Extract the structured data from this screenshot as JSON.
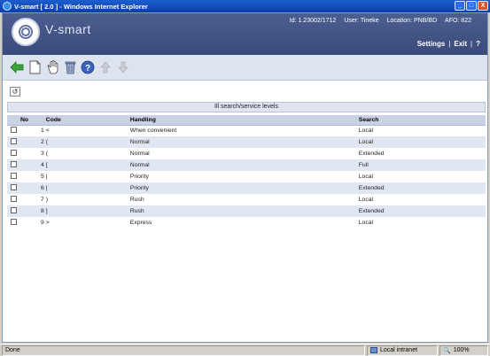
{
  "window": {
    "title": "V-smart [ 2.0 ] - Windows Internet Explorer",
    "minimize": "_",
    "maximize": "□",
    "close": "X"
  },
  "app": {
    "brand": "V-smart",
    "id_label": "Id: 1.23002/1712",
    "user_label": "User: Tineke",
    "location_label": "Location: PNB/BD",
    "afo_label": "AFO: 822",
    "links": {
      "settings": "Settings",
      "sep": "|",
      "exit": "Exit",
      "help": "?"
    }
  },
  "toolbar": {
    "icons": [
      "back-arrow-icon",
      "new-document-icon",
      "hand-select-icon",
      "trash-icon",
      "help-icon",
      "up-arrow-icon",
      "down-arrow-icon"
    ]
  },
  "refresh_symbol": "↺",
  "section_title": "Ill search/service levels",
  "table": {
    "headers": {
      "no": "No",
      "code": "Code",
      "handling": "Handling",
      "search": "Search"
    },
    "rows": [
      {
        "no": "1",
        "code": "<",
        "handling": "When convenient",
        "search": "Local"
      },
      {
        "no": "2",
        "code": "(",
        "handling": "Normal",
        "search": "Local"
      },
      {
        "no": "3",
        "code": "(",
        "handling": "Normal",
        "search": "Extended"
      },
      {
        "no": "4",
        "code": "[",
        "handling": "Normal",
        "search": "Full"
      },
      {
        "no": "5",
        "code": "|",
        "handling": "Priority",
        "search": "Local"
      },
      {
        "no": "6",
        "code": "|",
        "handling": "Priority",
        "search": "Extended"
      },
      {
        "no": "7",
        "code": ")",
        "handling": "Rush",
        "search": "Local"
      },
      {
        "no": "8",
        "code": "]",
        "handling": "Rush",
        "search": "Extended"
      },
      {
        "no": "9",
        "code": ">",
        "handling": "Express",
        "search": "Local"
      }
    ]
  },
  "statusbar": {
    "status": "Done",
    "zone": "Local intranet",
    "zoom": "100%"
  }
}
